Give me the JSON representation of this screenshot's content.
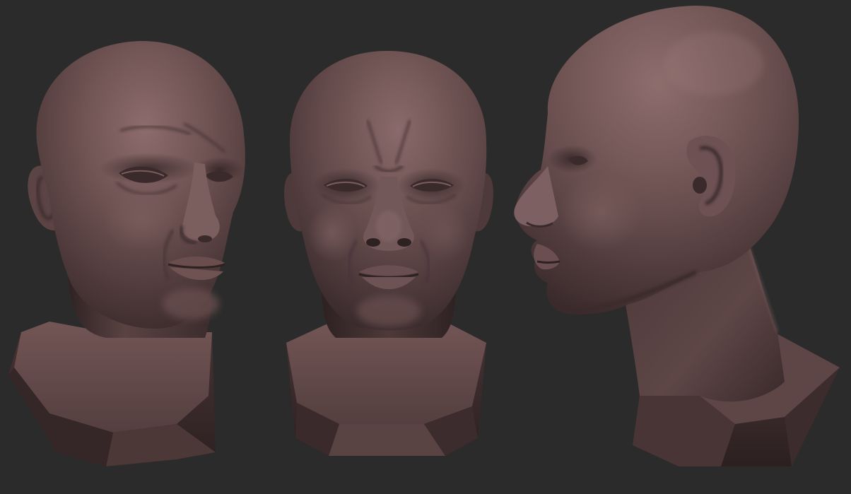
{
  "scene": {
    "views": [
      {
        "id": "three-quarter",
        "label": ""
      },
      {
        "id": "front",
        "label": ""
      },
      {
        "id": "profile",
        "label": ""
      }
    ]
  },
  "colors": {
    "background": "#2b2b2b",
    "clay_base": "#5e4646",
    "clay_light": "#8a6a6a",
    "clay_mid": "#6c5050",
    "clay_dark": "#3b2a2b",
    "clay_deep": "#2a1e1f"
  }
}
